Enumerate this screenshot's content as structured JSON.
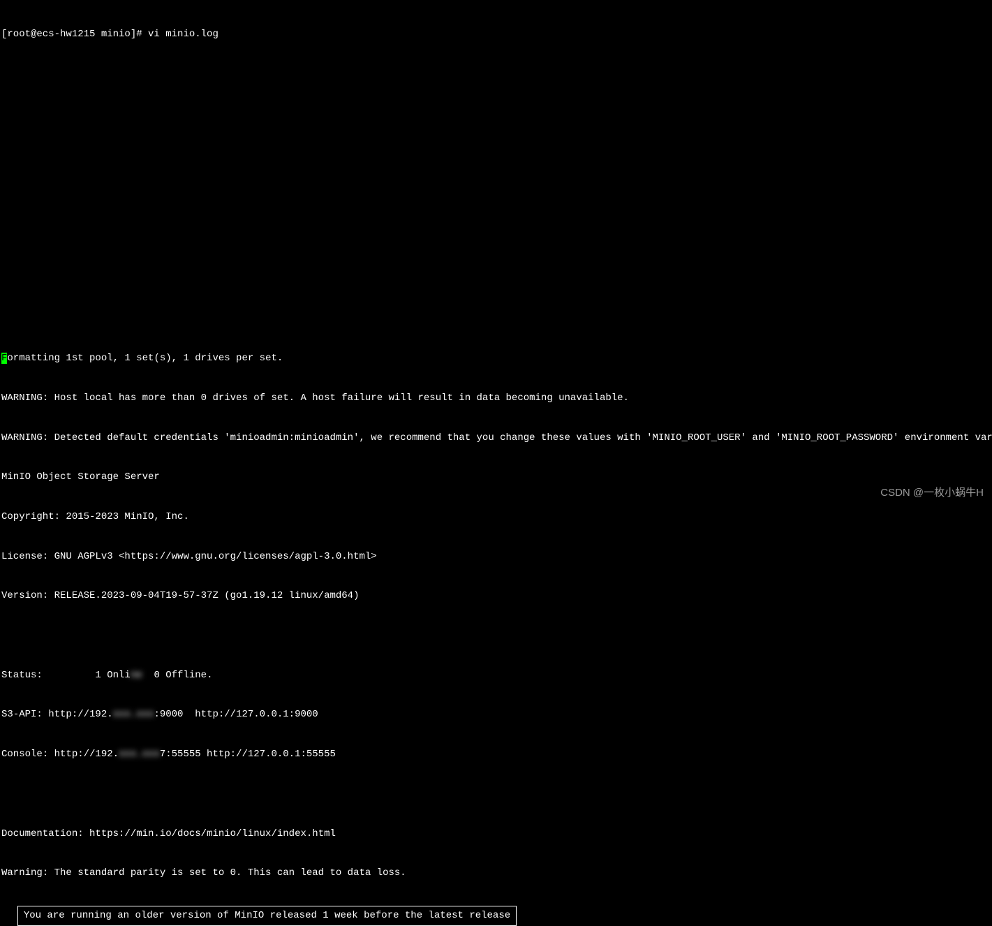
{
  "prompt": "[root@ecs-hw1215 minio]# vi minio.log",
  "cursor_char": "F",
  "log": {
    "line1_rest": "ormatting 1st pool, 1 set(s), 1 drives per set.",
    "line2": "WARNING: Host local has more than 0 drives of set. A host failure will result in data becoming unavailable.",
    "line3": "WARNING: Detected default credentials 'minioadmin:minioadmin', we recommend that you change these values with 'MINIO_ROOT_USER' and 'MINIO_ROOT_PASSWORD' environment variables",
    "line4": "MinIO Object Storage Server",
    "line5": "Copyright: 2015-2023 MinIO, Inc.",
    "line6": "License: GNU AGPLv3 <https://www.gnu.org/licenses/agpl-3.0.html>",
    "line7": "Version: RELEASE.2023-09-04T19-57-37Z (go1.19.12 linux/amd64)",
    "status_prefix": "Status:         1 Onli",
    "status_blur": "ne  ",
    "status_suffix": "0 Offline.",
    "s3_prefix": "S3-API: http://192.",
    "s3_blur": "xxx.xxx",
    "s3_suffix": ":9000  http://127.0.0.1:9000",
    "console_prefix": "Console: http://192.",
    "console_blur": "xxx.xxx",
    "console_suffix": "7:55555 http://127.0.0.1:55555",
    "docs": "Documentation: https://min.io/docs/minio/linux/index.html",
    "parity": "Warning: The standard parity is set to 0. This can lead to data loss.",
    "boxed": "You are running an older version of MinIO released 1 week before the latest release"
  },
  "watermark": "CSDN @一枚小蜗牛H"
}
